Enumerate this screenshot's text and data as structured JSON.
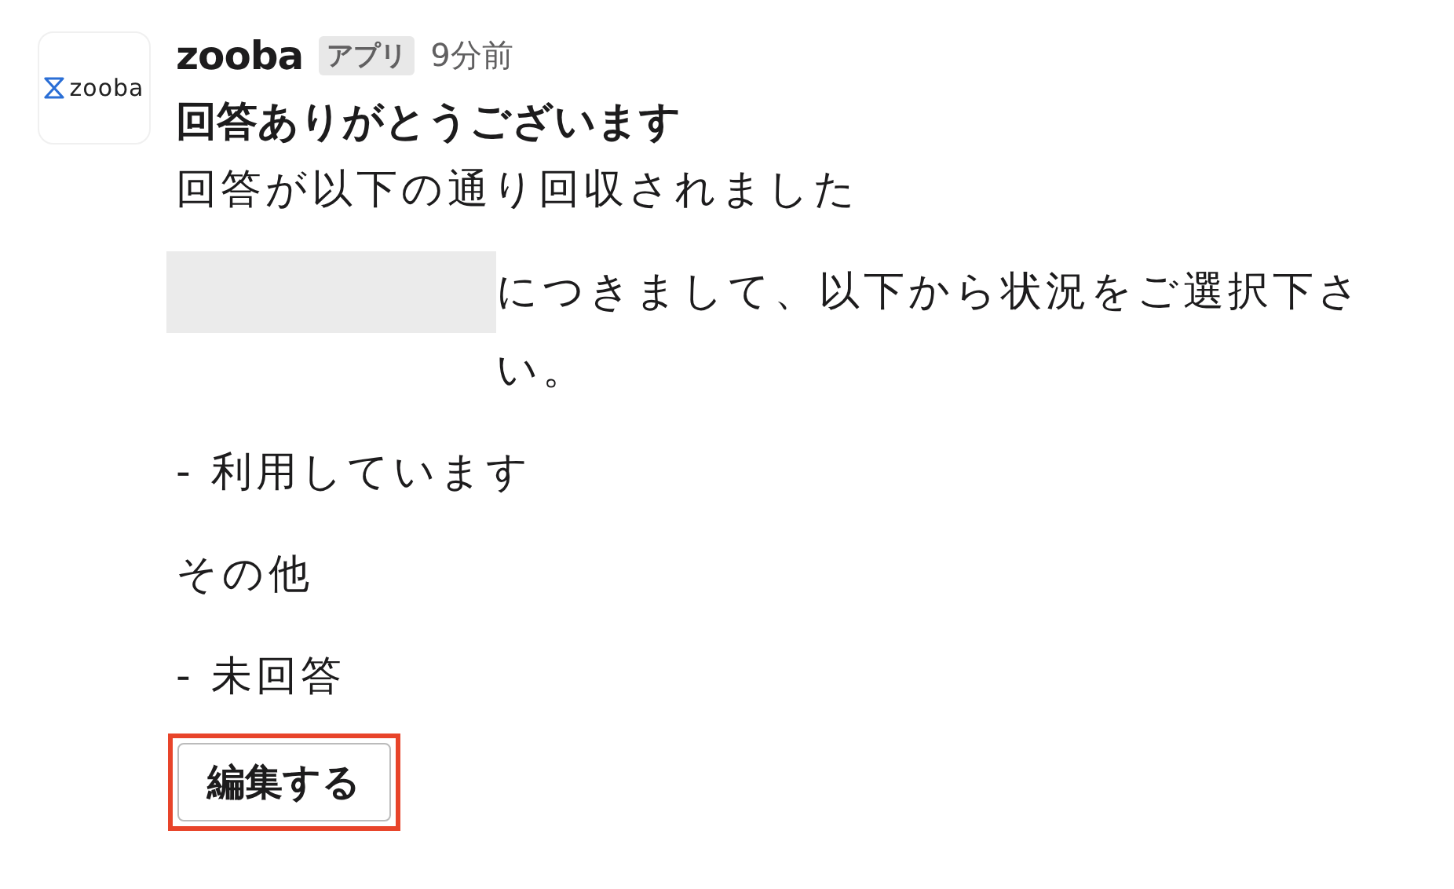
{
  "message": {
    "avatar_logo_text": "zooba",
    "sender": "zooba",
    "badge": "アプリ",
    "time": "9分前",
    "title": "回答ありがとうございます",
    "lines": [
      {
        "kind": "text",
        "text": "回答が以下の通り回収されました"
      },
      {
        "kind": "redacted_text",
        "text": "につきまして、以下から状況をご選択下さい。"
      },
      {
        "kind": "text",
        "text": "- 利用しています"
      },
      {
        "kind": "text",
        "text": "その他"
      },
      {
        "kind": "text",
        "text": "- 未回答"
      }
    ],
    "button": {
      "label": "編集する",
      "highlighted": true
    }
  }
}
